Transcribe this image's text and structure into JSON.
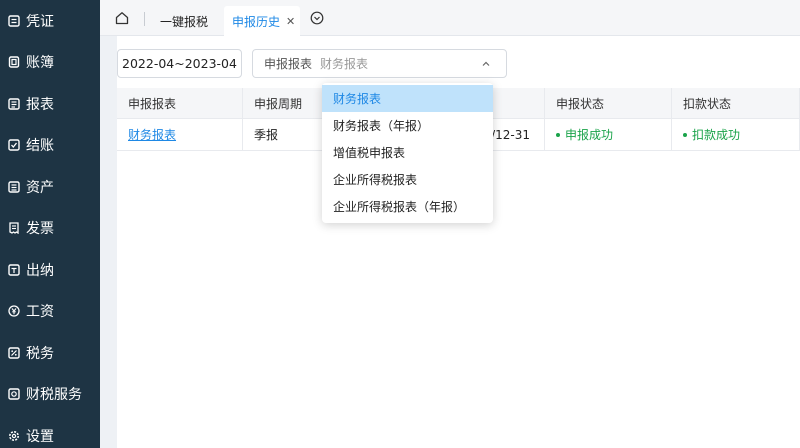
{
  "sidebar": {
    "items": [
      {
        "label": "凭证",
        "icon": "voucher-icon"
      },
      {
        "label": "账簿",
        "icon": "ledger-icon"
      },
      {
        "label": "报表",
        "icon": "report-icon"
      },
      {
        "label": "结账",
        "icon": "checkout-icon"
      },
      {
        "label": "资产",
        "icon": "asset-icon"
      },
      {
        "label": "发票",
        "icon": "invoice-icon"
      },
      {
        "label": "出纳",
        "icon": "cashier-icon"
      },
      {
        "label": "工资",
        "icon": "yen-icon"
      },
      {
        "label": "税务",
        "icon": "tax-icon"
      },
      {
        "label": "财税服务",
        "icon": "service-icon"
      },
      {
        "label": "设置",
        "icon": "gear-icon"
      }
    ]
  },
  "tabs": [
    {
      "label": "一键报税"
    },
    {
      "label": "申报历史",
      "active": true
    }
  ],
  "filters": {
    "date_range": "2022-04~2023-04",
    "select_label": "申报报表",
    "select_value": "财务报表"
  },
  "table": {
    "headers": [
      "申报报表",
      "申报周期",
      "",
      "申报状态",
      "扣款状态"
    ],
    "rows": [
      {
        "report": "财务报表",
        "period": "季报",
        "date_fragment": "/12-31",
        "declare_status": "申报成功",
        "payment_status": "扣款成功"
      }
    ]
  },
  "dropdown": {
    "options": [
      "财务报表",
      "财务报表（年报）",
      "增值税申报表",
      "企业所得税报表",
      "企业所得税报表（年报）"
    ],
    "selected": "财务报表"
  },
  "colors": {
    "sidebar_bg": "#1e3444",
    "accent": "#1e88e5",
    "success": "#1aa34a",
    "selected_option_bg": "#bfe2fb"
  }
}
